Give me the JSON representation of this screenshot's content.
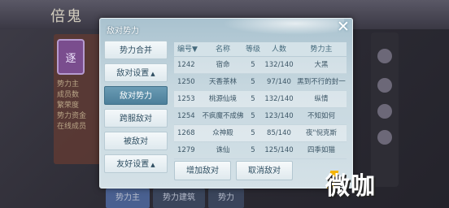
{
  "background": {
    "logo": "倍鬼",
    "emblem": "逐",
    "info_lines": [
      "势力主",
      "成员数",
      "繁荣度",
      "势力资金",
      "在线成员"
    ],
    "bottom_tabs": [
      {
        "label": "势力主"
      },
      {
        "label": "势力建筑"
      },
      {
        "label": "势力"
      }
    ]
  },
  "dialog": {
    "title": "敌对势力",
    "close_symbol": "✕"
  },
  "side_menu": [
    {
      "label": "势力合并",
      "arrow": ""
    },
    {
      "label": "敌对设置",
      "arrow": "▲"
    },
    {
      "label": "敌对势力",
      "arrow": ""
    },
    {
      "label": "跨服敌对",
      "arrow": ""
    },
    {
      "label": "被敌对",
      "arrow": ""
    },
    {
      "label": "友好设置",
      "arrow": "▲"
    }
  ],
  "table": {
    "headers": {
      "id": "编号▼",
      "name": "名称",
      "level": "等级",
      "members": "人数",
      "lord": "势力主"
    },
    "rows": [
      {
        "id": "1242",
        "name": "宿命",
        "level": "5",
        "members": "132/140",
        "lord": "大黑"
      },
      {
        "id": "1250",
        "name": "天香茶林",
        "level": "5",
        "members": "97/140",
        "lord": "黑到不行的封一"
      },
      {
        "id": "1253",
        "name": "桃源仙境",
        "level": "5",
        "members": "132/140",
        "lord": "纵情"
      },
      {
        "id": "1254",
        "name": "不疯魔不成佛",
        "level": "5",
        "members": "123/140",
        "lord": "不知如何"
      },
      {
        "id": "1268",
        "name": "众神殿",
        "level": "5",
        "members": "85/140",
        "lord": "夜\"倪克斯"
      },
      {
        "id": "1279",
        "name": "诛仙",
        "level": "5",
        "members": "125/140",
        "lord": "四季如猫"
      }
    ]
  },
  "buttons": {
    "add_enemy": "增加敌对",
    "cancel_enemy": "取消敌对"
  },
  "watermark": "微咖"
}
